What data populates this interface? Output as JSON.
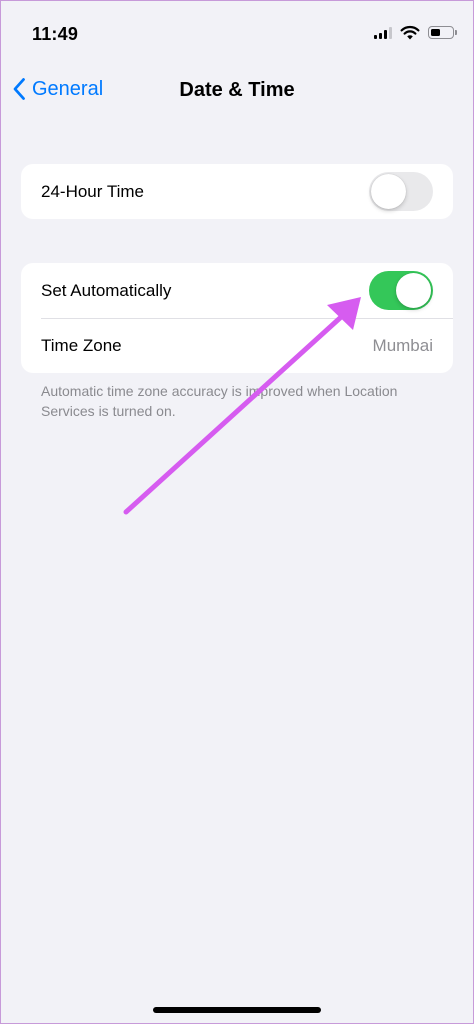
{
  "status_bar": {
    "time": "11:49",
    "icons": [
      "cellular-signal-icon",
      "wifi-icon",
      "battery-icon"
    ],
    "signal_bars_filled": 3,
    "signal_bars_total": 4,
    "battery_level": 0.4
  },
  "nav": {
    "back_label": "General",
    "back_icon": "chevron-left-icon",
    "title": "Date & Time",
    "accent_color": "#007aff"
  },
  "groups": {
    "time_format": {
      "label": "24-Hour Time",
      "toggle_on": false
    },
    "automatic": {
      "set_automatically_label": "Set Automatically",
      "set_automatically_on": true,
      "time_zone_label": "Time Zone",
      "time_zone_value": "Mumbai"
    }
  },
  "footer_note": "Automatic time zone accuracy is improved when Location Services is turned on.",
  "annotation": {
    "type": "arrow-icon",
    "color": "#d65cf0",
    "points_to": "set-automatically-toggle"
  },
  "colors": {
    "background": "#f2f2f7",
    "toggle_on": "#34c759",
    "toggle_off": "#e9e9eb",
    "secondary_text": "#8e8e93"
  }
}
